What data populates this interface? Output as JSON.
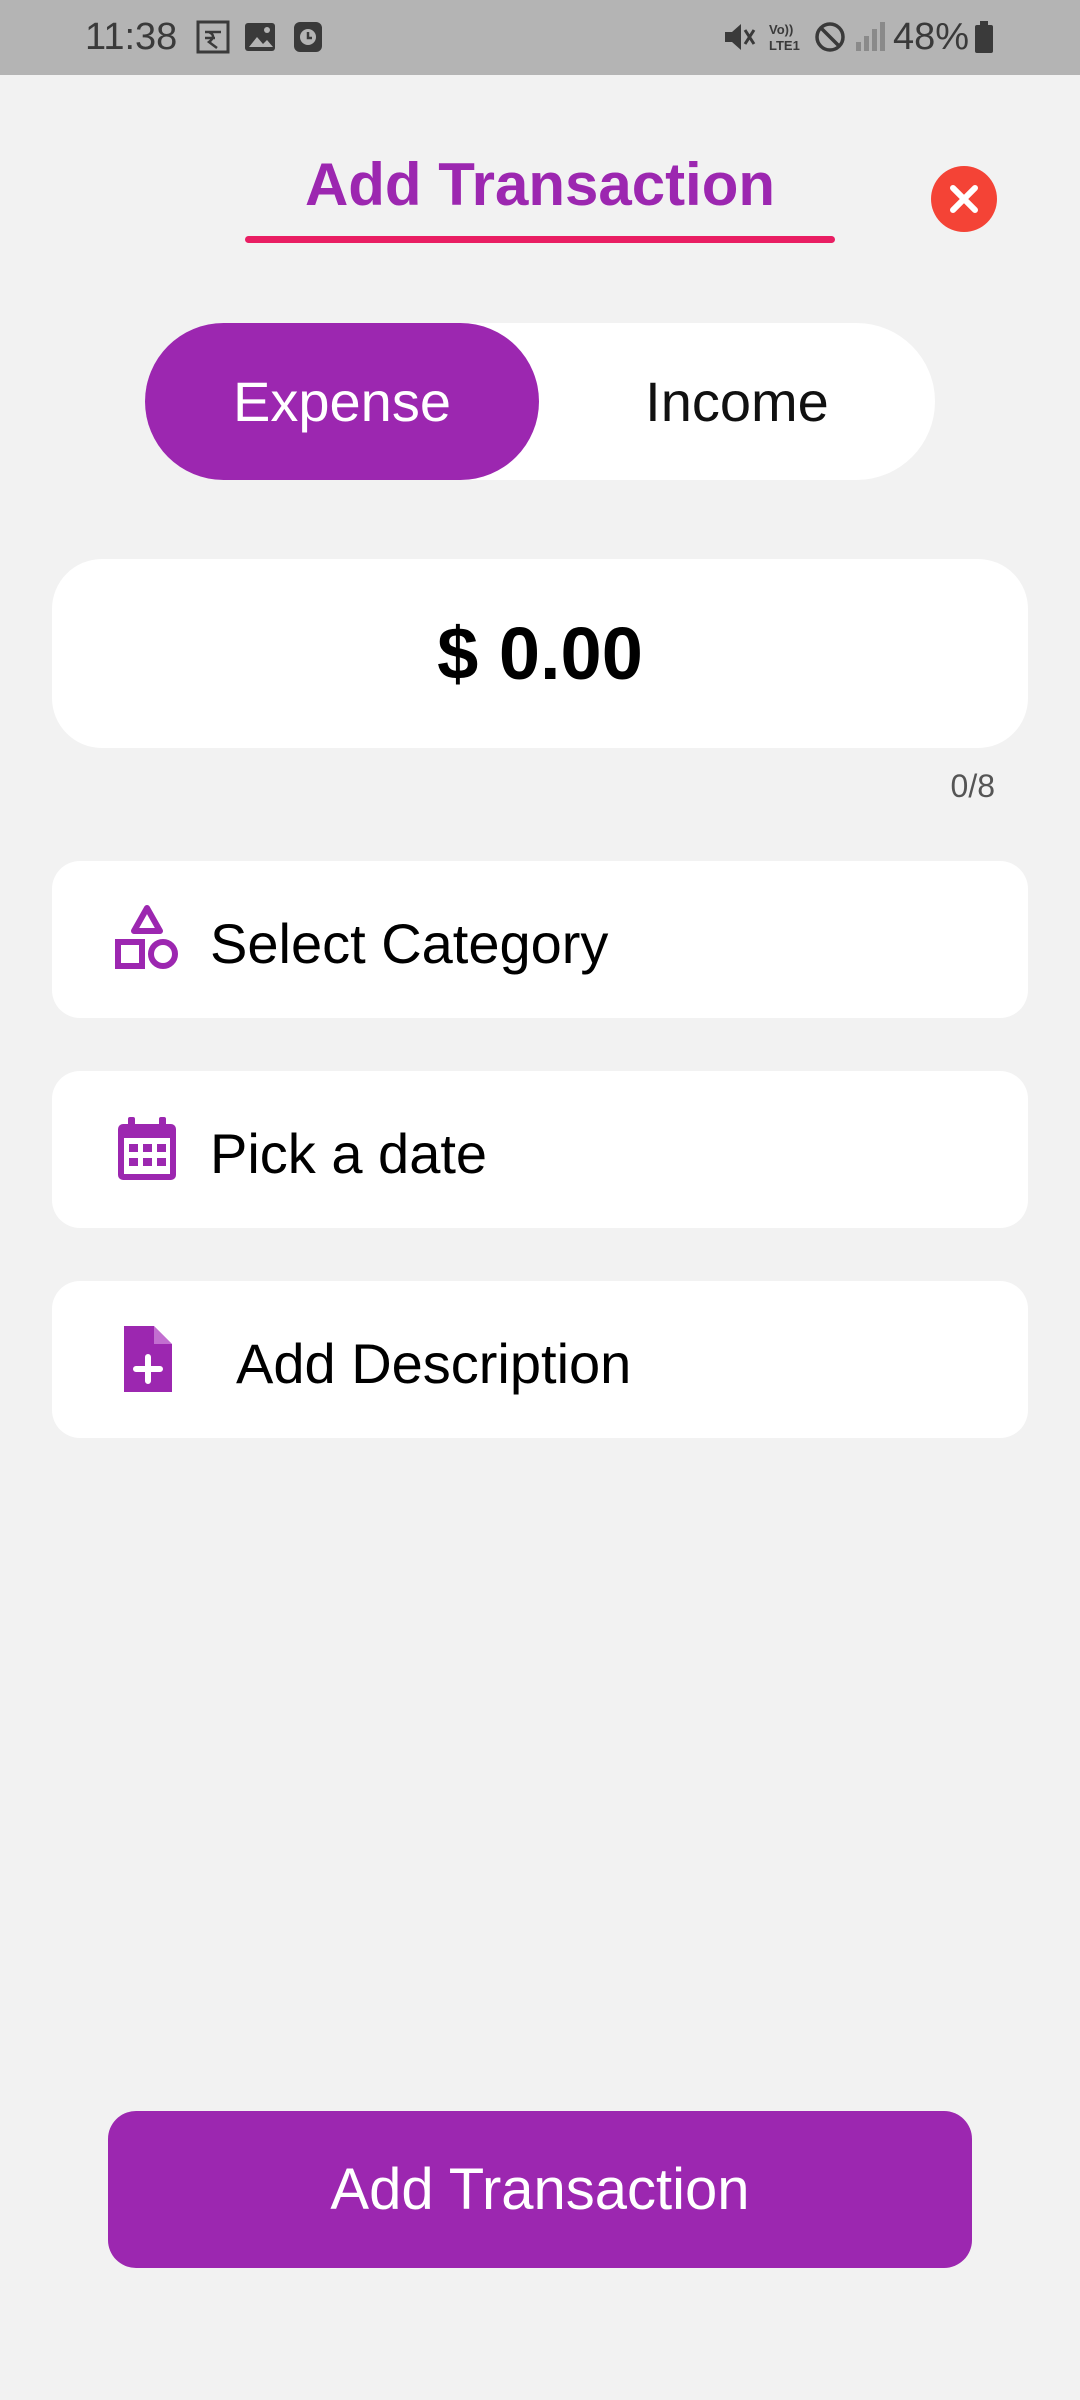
{
  "status_bar": {
    "time": "11:38",
    "battery": "48%",
    "icons": [
      "currency-notification-icon",
      "gallery-icon",
      "clock-icon",
      "mute-icon",
      "volte-icon",
      "do-not-disturb-icon",
      "signal-icon",
      "battery-icon"
    ]
  },
  "header": {
    "title": "Add Transaction",
    "close_icon": "close-icon"
  },
  "toggle": {
    "expense_label": "Expense",
    "income_label": "Income",
    "selected": "Expense"
  },
  "amount": {
    "value": "$ 0.00",
    "counter": "0/8"
  },
  "fields": {
    "category_label": "Select Category",
    "category_icon": "category-shapes-icon",
    "date_label": "Pick a date",
    "date_icon": "calendar-icon",
    "description_label": "Add Description",
    "description_icon": "note-add-icon"
  },
  "submit": {
    "label": "Add Transaction"
  },
  "colors": {
    "accent": "#9c27b0",
    "underline": "#e91e63",
    "close": "#f44336",
    "background": "#f2f2f2"
  }
}
